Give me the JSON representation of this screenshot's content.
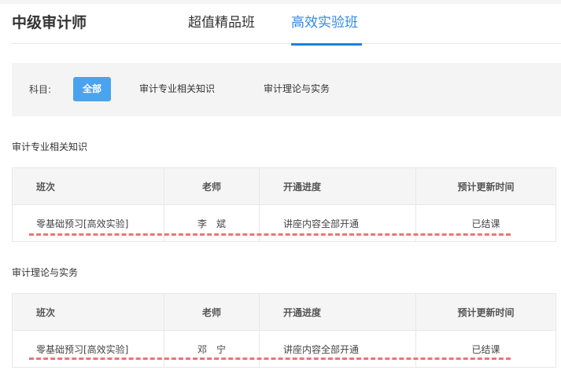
{
  "header": {
    "title": "中级审计师",
    "tabs": [
      {
        "label": "超值精品班"
      },
      {
        "label": "高效实验班",
        "active": true
      }
    ]
  },
  "filter": {
    "label": "科目:",
    "options": [
      {
        "label": "全部",
        "active": true
      },
      {
        "label": "审计专业相关知识"
      },
      {
        "label": "审计理论与实务"
      }
    ]
  },
  "columns": [
    "班次",
    "老师",
    "开通进度",
    "预计更新时间"
  ],
  "sections": [
    {
      "title": "审计专业相关知识",
      "rows": [
        {
          "class": "零基础预习[高效实验]",
          "teacher": "李　斌",
          "progress": "讲座内容全部开通",
          "update": "已结课"
        }
      ]
    },
    {
      "title": "审计理论与实务",
      "rows": [
        {
          "class": "零基础预习[高效实验]",
          "teacher": "邓　宁",
          "progress": "讲座内容全部开通",
          "update": "已结课"
        }
      ]
    }
  ],
  "colors": {
    "accent": "#2f8ae5",
    "active_button": "#4aa3ef",
    "dash": "#f27272"
  }
}
